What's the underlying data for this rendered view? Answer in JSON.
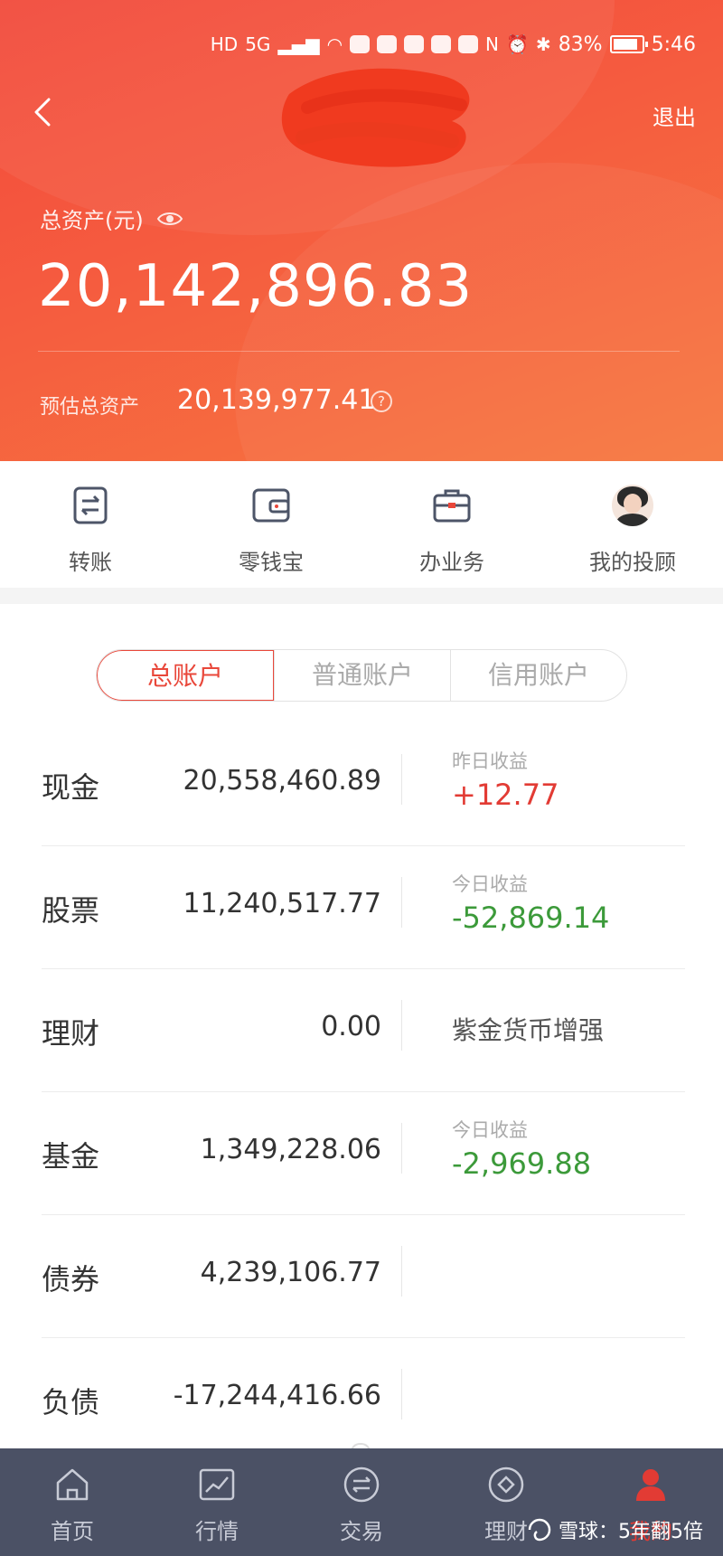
{
  "status_bar": {
    "network_hd": "HD",
    "network_gen": "5G",
    "nfc": "N",
    "battery": "83%",
    "time": "5:46"
  },
  "header": {
    "logout": "退出",
    "total_assets_label": "总资产(元)",
    "total_assets_value": "20,142,896.83",
    "estimated_label": "预估总资产",
    "estimated_value": "20,139,977.41",
    "help": "?"
  },
  "quick_actions": [
    {
      "label": "转账",
      "icon": "transfer-icon"
    },
    {
      "label": "零钱宝",
      "icon": "wallet-icon"
    },
    {
      "label": "办业务",
      "icon": "briefcase-icon"
    },
    {
      "label": "我的投顾",
      "icon": "advisor-avatar"
    }
  ],
  "account_tabs": [
    "总账户",
    "普通账户",
    "信用账户"
  ],
  "accounts": [
    {
      "name": "现金",
      "amount": "20,558,460.89",
      "side_label": "昨日收益",
      "side_value": "+12.77",
      "tone": "pos"
    },
    {
      "name": "股票",
      "amount": "11,240,517.77",
      "side_label": "今日收益",
      "side_value": "-52,869.14",
      "tone": "neg"
    },
    {
      "name": "理财",
      "amount": "0.00",
      "side_text": "紫金货币增强"
    },
    {
      "name": "基金",
      "amount": "1,349,228.06",
      "side_label": "今日收益",
      "side_value": "-2,969.88",
      "tone": "neg"
    },
    {
      "name": "债券",
      "amount": "4,239,106.77"
    },
    {
      "name": "负债",
      "amount": "-17,244,416.66"
    }
  ],
  "bottom_nav": [
    {
      "label": "首页",
      "icon": "home-icon"
    },
    {
      "label": "行情",
      "icon": "chart-icon"
    },
    {
      "label": "交易",
      "icon": "exchange-icon"
    },
    {
      "label": "理财",
      "icon": "diamond-icon"
    },
    {
      "label": "我的",
      "icon": "profile-icon",
      "active": true
    }
  ],
  "watermark": "雪球：5年翻5倍",
  "colors": {
    "accent_red": "#e9473a",
    "positive": "#e23b34",
    "negative": "#3c9a3a",
    "nav_bg": "#4b5165"
  }
}
